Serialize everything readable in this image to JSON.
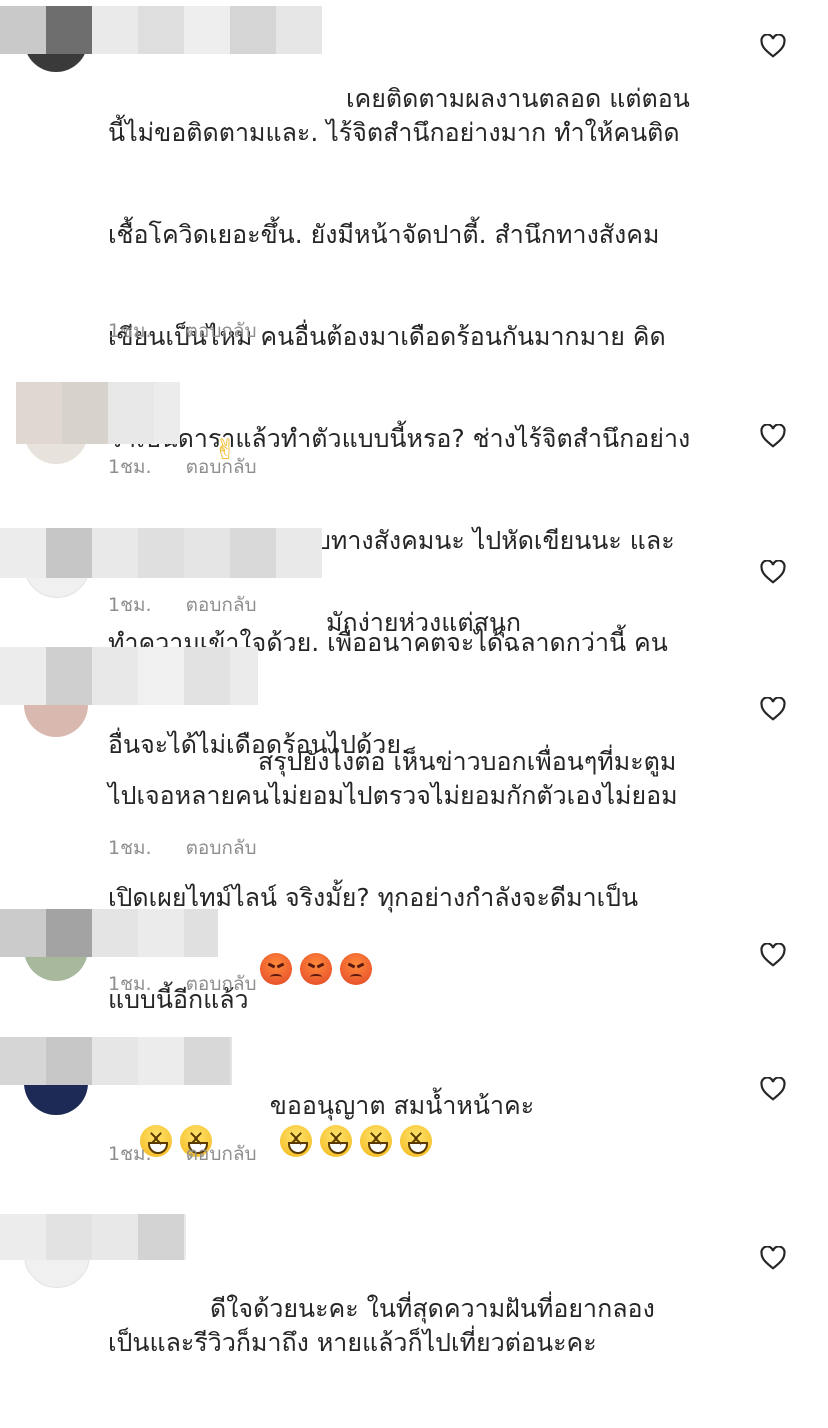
{
  "comments": [
    {
      "text_lines": [
        "เคยติดตามผลงานตลอด แต่ตอน",
        "นี้ไม่ขอติดตามและ. ไร้จิตสำนึกอย่างมาก ทำให้คนติด",
        "เชื้อโควิดเยอะขึ้น. ยังมีหน้าจัดปาตี้. สำนึกทางสังคม",
        "เขียนเป็นไหม คนอื่นต้องมาเดือดร้อนกันมากมาย คิด",
        "ว่าเป็นดาราแล้วทำตัวแบบนี้หรอ? ช่างไร้จิตสำนึกอย่าง",
        "มาก ความรับผิดชอบทางสังคมนะ ไปหัดเขียนนะ และ",
        "ทำความเข้าใจด้วย. เพื่ออนาคตจะได้ฉลาดกว่านี้ คน",
        "อื่นจะได้ไม่เดือดร้อนไปด้วย."
      ],
      "time": "1ชม.",
      "reply": "ตอบกลับ"
    },
    {
      "text_lines": [
        ""
      ],
      "emoji": "victory-hand",
      "time": "1ชม.",
      "reply": "ตอบกลับ"
    },
    {
      "text_lines": [
        "มักง่ายห่วงแต่สนุก"
      ],
      "time": "1ชม.",
      "reply": "ตอบกลับ"
    },
    {
      "text_lines": [
        "สรุปยังไงต่อ เห็นข่าวบอกเพื่อนๆที่มะตูม",
        "ไปเจอหลายคนไม่ยอมไปตรวจไม่ยอมกักตัวเองไม่ยอม",
        "เปิดเผยไทม์ไลน์ จริงมั้ย? ทุกอย่างกำลังจะดีมาเป็น",
        "แบบนี้อีกแล้ว"
      ],
      "time": "1ชม.",
      "reply": "ตอบกลับ"
    },
    {
      "text_lines": [
        ""
      ],
      "emoji": "angry-face x3",
      "time": "1ชม.",
      "reply": "ตอบกลับ"
    },
    {
      "text_lines": [
        "ขออนุญาต สมน้ำหน้าคะ"
      ],
      "emoji": "laughing-face x6",
      "time": "1ชม.",
      "reply": "ตอบกลับ"
    },
    {
      "text_lines": [
        "ดีใจด้วยนะคะ ในที่สุดความฝันที่อยากลอง",
        "เป็นและรีวิวก็มาถึง หายแล้วก็ไปเที่ยวต่อนะคะ"
      ]
    }
  ],
  "icons": {
    "like": "heart-outline-icon"
  },
  "colors": {
    "text": "#262626",
    "meta": "#8e8e8e",
    "background": "#ffffff"
  }
}
